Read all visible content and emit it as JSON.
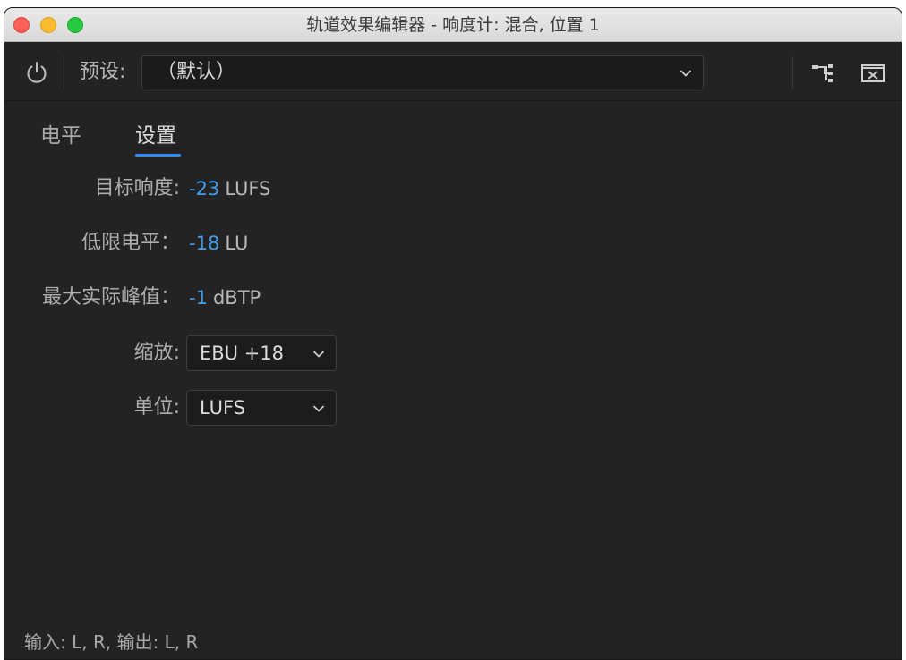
{
  "window": {
    "title": "轨道效果编辑器 - 响度计: 混合, 位置 1"
  },
  "toolbar": {
    "preset_label": "预设:",
    "preset_value": "（默认）",
    "power_icon": "power-icon",
    "routing_icon": "routing-icon",
    "close_effect_icon": "close-box-icon"
  },
  "tabs": [
    {
      "label": "电平",
      "active": false
    },
    {
      "label": "设置",
      "active": true
    }
  ],
  "settings": {
    "target_loudness": {
      "label": "目标响度:",
      "value": "-23",
      "unit": "LUFS"
    },
    "floor_level": {
      "label": "低限电平：",
      "value": "-18",
      "unit": "LU"
    },
    "max_true_peak": {
      "label": "最大实际峰值：",
      "value": "-1",
      "unit": "dBTP"
    },
    "scale": {
      "label": "缩放:",
      "value": "EBU +18"
    },
    "units": {
      "label": "单位:",
      "value": "LUFS"
    }
  },
  "footer": {
    "io_text": "输入: L, R,   输出: L, R"
  },
  "colors": {
    "accent": "#2d8ceb",
    "value_blue": "#3f9ef0",
    "panel_bg": "#232323"
  }
}
